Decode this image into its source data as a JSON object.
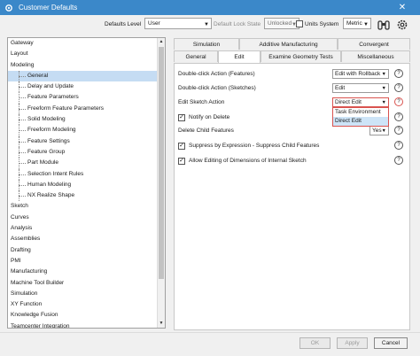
{
  "window": {
    "title": "Customer Defaults",
    "close_label": "✕"
  },
  "toolbar": {
    "defaults_level_label": "Defaults Level",
    "defaults_level_value": "User",
    "lock_state_label": "Default Lock State",
    "lock_state_value": "Unlocked",
    "units_label": "Units System",
    "units_value": "Metric",
    "icons": [
      "binoculars-icon",
      "settings-icon"
    ]
  },
  "tree": {
    "items": [
      {
        "label": "Gateway",
        "level": 0
      },
      {
        "label": "Layout",
        "level": 0
      },
      {
        "label": "Modeling",
        "level": 0
      },
      {
        "label": "General",
        "level": 1,
        "selected": true
      },
      {
        "label": "Delay and Update",
        "level": 1
      },
      {
        "label": "Feature Parameters",
        "level": 1
      },
      {
        "label": "Freeform Feature Parameters",
        "level": 1
      },
      {
        "label": "Solid Modeling",
        "level": 1
      },
      {
        "label": "Freeform Modeling",
        "level": 1
      },
      {
        "label": "Feature Settings",
        "level": 1
      },
      {
        "label": "Feature Group",
        "level": 1
      },
      {
        "label": "Part Module",
        "level": 1
      },
      {
        "label": "Selection Intent Rules",
        "level": 1
      },
      {
        "label": "Human Modeling",
        "level": 1
      },
      {
        "label": "NX Realize Shape",
        "level": 1
      },
      {
        "label": "Sketch",
        "level": 0
      },
      {
        "label": "Curves",
        "level": 0
      },
      {
        "label": "Analysis",
        "level": 0
      },
      {
        "label": "Assemblies",
        "level": 0
      },
      {
        "label": "Drafting",
        "level": 0
      },
      {
        "label": "PMI",
        "level": 0
      },
      {
        "label": "Manufacturing",
        "level": 0
      },
      {
        "label": "Machine Tool Builder",
        "level": 0
      },
      {
        "label": "Simulation",
        "level": 0
      },
      {
        "label": "XY Function",
        "level": 0
      },
      {
        "label": "Knowledge Fusion",
        "level": 0
      },
      {
        "label": "Teamcenter Integration",
        "level": 0
      }
    ]
  },
  "tabs": {
    "row1": [
      "Simulation",
      "Additive Manufacturing",
      "Convergent"
    ],
    "row2": [
      "General",
      "Edit",
      "Examine Geometry Tests",
      "Miscellaneous"
    ],
    "active": "Edit"
  },
  "edit": {
    "dbl_features_label": "Double-click Action (Features)",
    "dbl_features_value": "Edit with Rollback",
    "dbl_sketches_label": "Double-click Action (Sketches)",
    "dbl_sketches_value": "Edit",
    "sketch_action_label": "Edit Sketch Action",
    "sketch_action_value": "Direct Edit",
    "sketch_action_options": [
      "Task Environment",
      "Direct Edit"
    ],
    "notify_delete_label": "Notify on Delete",
    "delete_child_label": "Delete Child Features",
    "delete_child_value": "Yes",
    "suppress_label": "Suppress by Expression - Suppress Child Features",
    "allow_editing_label": "Allow Editing of Dimensions of Internal Sketch",
    "help_glyph": "?"
  },
  "footer": {
    "ok": "OK",
    "apply": "Apply",
    "cancel": "Cancel"
  },
  "colors": {
    "titlebar": "#3b88c9",
    "selection": "#c5dcf3",
    "highlight": "#d9534f"
  }
}
